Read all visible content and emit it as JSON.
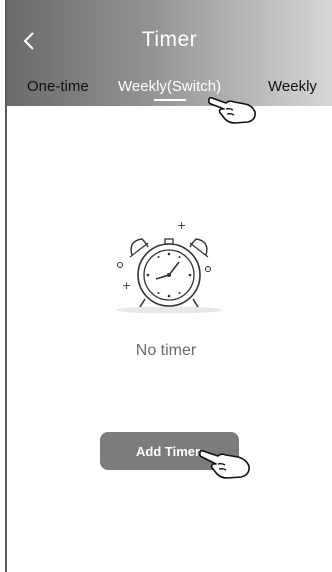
{
  "header": {
    "back_icon": "chevron-left-icon",
    "title": "Timer",
    "tabs": [
      {
        "label": "One-time",
        "active": false
      },
      {
        "label": "Weekly(Switch)",
        "active": true
      },
      {
        "label": "Weekly",
        "active": false
      }
    ]
  },
  "empty_state": {
    "icon": "alarm-clock-icon",
    "message": "No timer"
  },
  "actions": {
    "add_timer_label": "Add Timer"
  },
  "annotations": {
    "pointer_icon": "pointing-hand-icon"
  },
  "colors": {
    "header_start": "#6b6b6b",
    "header_end": "#d6d6d6",
    "button": "#7c7c7c",
    "text_muted": "#6a6a6a"
  }
}
